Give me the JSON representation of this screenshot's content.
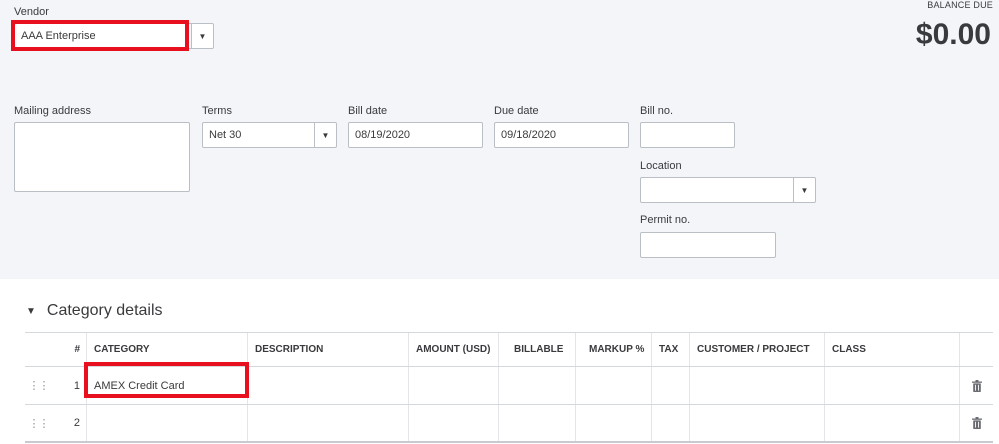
{
  "vendor": {
    "label": "Vendor",
    "value": "AAA Enterprise"
  },
  "balance": {
    "label": "BALANCE DUE",
    "amount": "$0.00"
  },
  "mailing_address": {
    "label": "Mailing address",
    "value": ""
  },
  "terms": {
    "label": "Terms",
    "value": "Net 30"
  },
  "bill_date": {
    "label": "Bill date",
    "value": "08/19/2020"
  },
  "due_date": {
    "label": "Due date",
    "value": "09/18/2020"
  },
  "bill_no": {
    "label": "Bill no.",
    "value": ""
  },
  "location": {
    "label": "Location",
    "value": ""
  },
  "permit_no": {
    "label": "Permit no.",
    "value": ""
  },
  "category_details": {
    "title": "Category details",
    "columns": {
      "num": "#",
      "category": "CATEGORY",
      "description": "DESCRIPTION",
      "amount": "AMOUNT (USD)",
      "billable": "BILLABLE",
      "markup": "MARKUP %",
      "tax": "TAX",
      "customer": "CUSTOMER / PROJECT",
      "class": "CLASS"
    },
    "rows": [
      {
        "num": "1",
        "category": "AMEX Credit Card",
        "description": "",
        "amount": "",
        "billable": "",
        "markup": "",
        "tax": "",
        "customer": "",
        "class": ""
      },
      {
        "num": "2",
        "category": "",
        "description": "",
        "amount": "",
        "billable": "",
        "markup": "",
        "tax": "",
        "customer": "",
        "class": ""
      }
    ]
  },
  "icons": {
    "dropdown": "caret-down-icon",
    "grip": "drag-handle-icon",
    "delete": "trash-icon",
    "collapse": "triangle-down-icon"
  },
  "colors": {
    "highlight": "#e8101e",
    "panel_bg": "#f4f5f8"
  }
}
